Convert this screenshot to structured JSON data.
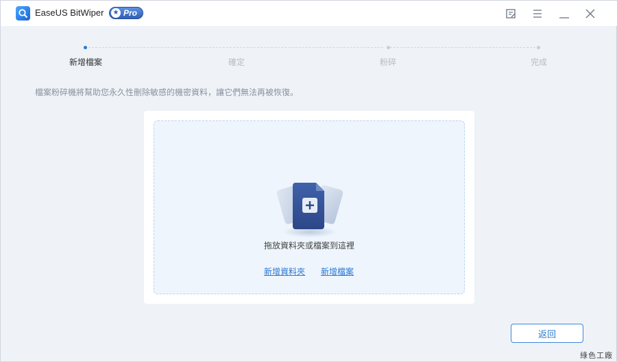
{
  "app": {
    "title": "EaseUS BitWiper",
    "badge": "Pro"
  },
  "titlebar_icons": [
    "feedback-icon",
    "menu-icon",
    "minimize-icon",
    "close-icon"
  ],
  "steps": [
    {
      "label": "新增檔案",
      "active": true
    },
    {
      "label": "確定",
      "active": false
    },
    {
      "label": "粉碎",
      "active": false
    },
    {
      "label": "完成",
      "active": false
    }
  ],
  "description": "檔案粉碎機將幫助您永久性刪除敏感的機密資料，讓它們無法再被恢復。",
  "dropzone": {
    "text": "拖放資料夾或檔案到這裡",
    "add_folder": "新增資料夾",
    "add_file": "新增檔案"
  },
  "back_button": "返回",
  "watermark": "綠色工廠",
  "colors": {
    "accent": "#1f7ae0",
    "link": "#2a78d2",
    "background": "#eff3f8",
    "dropzone": "#eef5fd"
  }
}
